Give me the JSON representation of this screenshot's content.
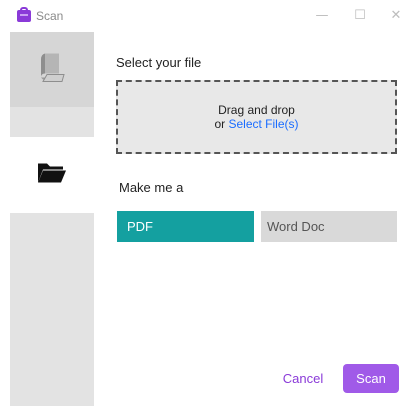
{
  "window": {
    "title": "Scan",
    "minimize_glyph": "—",
    "maximize_glyph": "☐",
    "close_glyph": "✕"
  },
  "sidebar": {
    "items": [
      {
        "name": "scan",
        "icon": "book-scan-icon",
        "selected": false
      },
      {
        "name": "open-file",
        "icon": "folder-icon",
        "selected": true
      }
    ]
  },
  "main": {
    "select_label": "Select your file",
    "dropzone": {
      "line1": "Drag and drop",
      "or_text": "or ",
      "link_text": "Select File(s)"
    },
    "make_label": "Make me a",
    "formats": [
      {
        "label": "PDF",
        "selected": true
      },
      {
        "label": "Word Doc",
        "selected": false
      }
    ]
  },
  "footer": {
    "cancel_label": "Cancel",
    "scan_label": "Scan"
  },
  "colors": {
    "accent": "#a05ae8",
    "selected_format": "#14a0a0",
    "link": "#1a6cff"
  }
}
